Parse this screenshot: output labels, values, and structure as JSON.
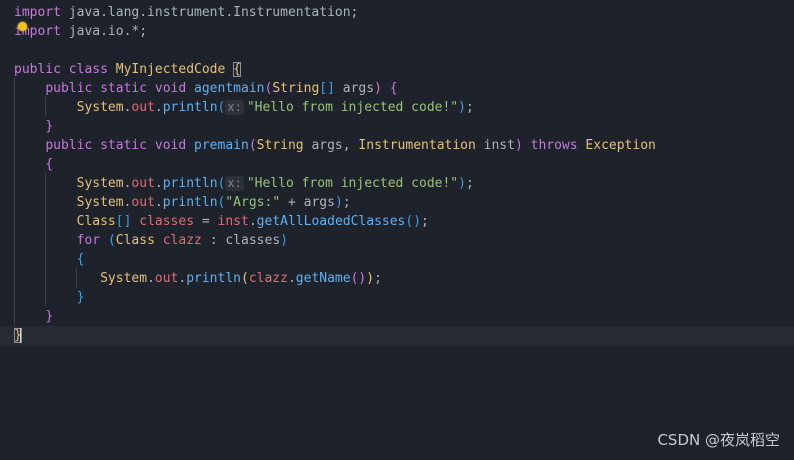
{
  "editor": {
    "lines": [
      {
        "t": [
          [
            "kw",
            "import"
          ],
          [
            "pl",
            " java.lang.instrument.Instrumentation;"
          ]
        ]
      },
      {
        "t": [
          [
            "kw",
            "import"
          ],
          [
            "pl",
            " java.io.*;"
          ]
        ]
      },
      {
        "t": []
      },
      {
        "t": [
          [
            "kw",
            "public class"
          ],
          [
            "pl",
            " "
          ],
          [
            "ty",
            "MyInjectedCode"
          ],
          [
            "pl",
            " "
          ],
          [
            "br1",
            "{"
          ]
        ]
      },
      {
        "t": [
          [
            "pl",
            "    "
          ],
          [
            "kw",
            "public static void"
          ],
          [
            "pl",
            " "
          ],
          [
            "fn",
            "agentmain"
          ],
          [
            "br2",
            "("
          ],
          [
            "ty",
            "String"
          ],
          [
            "br3",
            "[]"
          ],
          [
            "pl",
            " args"
          ],
          [
            "br2",
            ")"
          ],
          [
            "pl",
            " "
          ],
          [
            "br2",
            "{"
          ]
        ]
      },
      {
        "t": [
          [
            "pl",
            "        "
          ],
          [
            "ty",
            "System"
          ],
          [
            "pl",
            "."
          ],
          [
            "va",
            "out"
          ],
          [
            "pl",
            "."
          ],
          [
            "fn",
            "println"
          ],
          [
            "br3",
            "("
          ],
          [
            "hint",
            "x:"
          ],
          [
            "st",
            "\"Hello from injected code!\""
          ],
          [
            "br3",
            ")"
          ],
          [
            "pl",
            ";"
          ]
        ]
      },
      {
        "t": [
          [
            "pl",
            "    "
          ],
          [
            "br2",
            "}"
          ]
        ]
      },
      {
        "t": [
          [
            "pl",
            "    "
          ],
          [
            "kw",
            "public static void"
          ],
          [
            "pl",
            " "
          ],
          [
            "fn",
            "premain"
          ],
          [
            "br2",
            "("
          ],
          [
            "ty",
            "String"
          ],
          [
            "pl",
            " args, "
          ],
          [
            "ty",
            "Instrumentation"
          ],
          [
            "pl",
            " inst"
          ],
          [
            "br2",
            ")"
          ],
          [
            "pl",
            " "
          ],
          [
            "kw",
            "throws"
          ],
          [
            "pl",
            " "
          ],
          [
            "ty",
            "Exception"
          ]
        ]
      },
      {
        "t": [
          [
            "pl",
            "    "
          ],
          [
            "br2",
            "{"
          ]
        ]
      },
      {
        "t": [
          [
            "pl",
            "        "
          ],
          [
            "ty",
            "System"
          ],
          [
            "pl",
            "."
          ],
          [
            "va",
            "out"
          ],
          [
            "pl",
            "."
          ],
          [
            "fn",
            "println"
          ],
          [
            "br3",
            "("
          ],
          [
            "hint",
            "x:"
          ],
          [
            "st",
            "\"Hello from injected code!\""
          ],
          [
            "br3",
            ")"
          ],
          [
            "pl",
            ";"
          ]
        ]
      },
      {
        "t": [
          [
            "pl",
            "        "
          ],
          [
            "ty",
            "System"
          ],
          [
            "pl",
            "."
          ],
          [
            "va",
            "out"
          ],
          [
            "pl",
            "."
          ],
          [
            "fn",
            "println"
          ],
          [
            "br3",
            "("
          ],
          [
            "st",
            "\"Args:\""
          ],
          [
            "pl",
            " + args"
          ],
          [
            "br3",
            ")"
          ],
          [
            "pl",
            ";"
          ]
        ]
      },
      {
        "t": [
          [
            "pl",
            "        "
          ],
          [
            "ty",
            "Class"
          ],
          [
            "br3",
            "[]"
          ],
          [
            "pl",
            " "
          ],
          [
            "va",
            "classes"
          ],
          [
            "pl",
            " = "
          ],
          [
            "va",
            "inst"
          ],
          [
            "pl",
            "."
          ],
          [
            "fn",
            "getAllLoadedClasses"
          ],
          [
            "br3",
            "()"
          ],
          [
            "pl",
            ";"
          ]
        ]
      },
      {
        "t": [
          [
            "pl",
            "        "
          ],
          [
            "kw",
            "for"
          ],
          [
            "pl",
            " "
          ],
          [
            "br3",
            "("
          ],
          [
            "ty",
            "Class"
          ],
          [
            "pl",
            " "
          ],
          [
            "va",
            "clazz"
          ],
          [
            "pl",
            " : classes"
          ],
          [
            "br3",
            ")"
          ]
        ]
      },
      {
        "t": [
          [
            "pl",
            "        "
          ],
          [
            "br3",
            "{"
          ]
        ]
      },
      {
        "t": [
          [
            "pl",
            "           "
          ],
          [
            "ty",
            "System"
          ],
          [
            "pl",
            "."
          ],
          [
            "va",
            "out"
          ],
          [
            "pl",
            "."
          ],
          [
            "fn",
            "println"
          ],
          [
            "br1",
            "("
          ],
          [
            "va",
            "clazz"
          ],
          [
            "pl",
            "."
          ],
          [
            "fn",
            "getName"
          ],
          [
            "br2",
            "()"
          ],
          [
            "br1",
            ")"
          ],
          [
            "pl",
            ";"
          ]
        ]
      },
      {
        "t": [
          [
            "pl",
            "        "
          ],
          [
            "br3",
            "}"
          ]
        ]
      },
      {
        "t": [
          [
            "pl",
            "    "
          ],
          [
            "br2",
            "}"
          ]
        ]
      },
      {
        "t": [
          [
            "br1",
            "}"
          ]
        ]
      }
    ]
  },
  "colors": {
    "background": "#1e222a",
    "keyword": "#c678dd",
    "type": "#e5c07b",
    "function": "#61afef",
    "string": "#98c379",
    "variable": "#e06c75",
    "plain": "#abb2bf"
  },
  "icons": {
    "lightbulb": "lightbulb-icon"
  },
  "watermark": "CSDN @夜岚稻空"
}
